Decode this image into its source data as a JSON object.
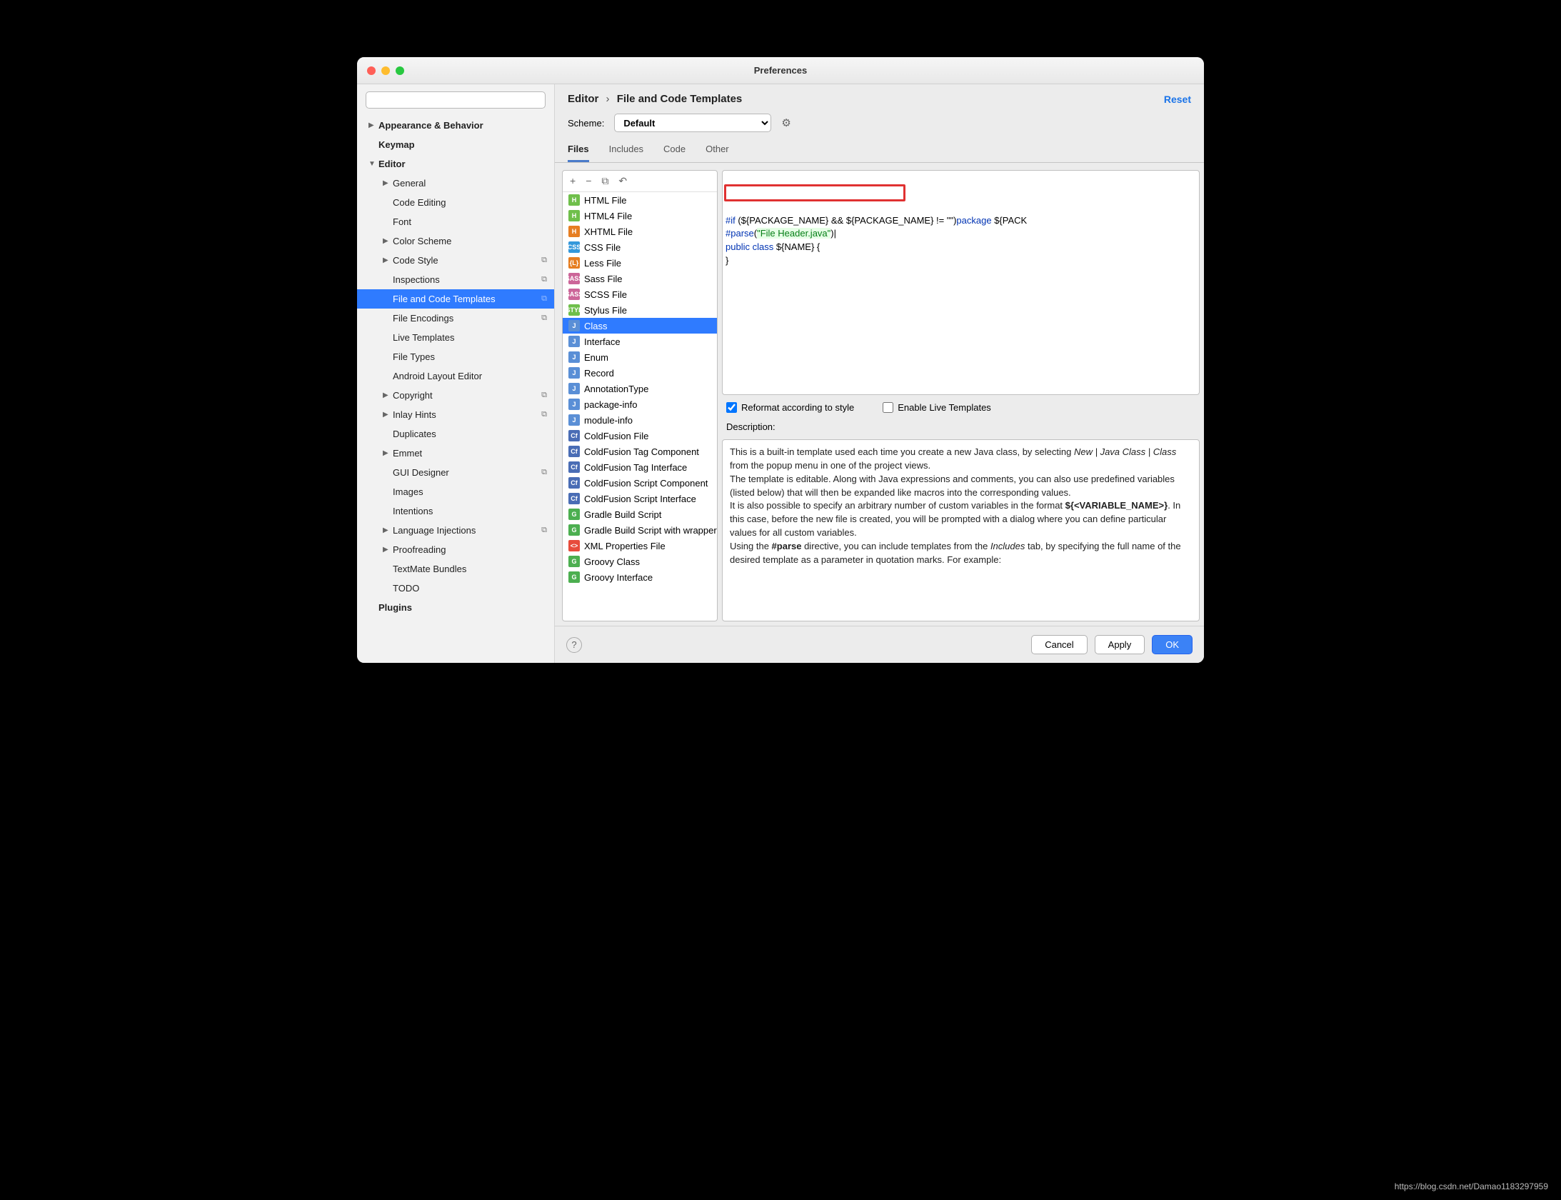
{
  "window_title": "Preferences",
  "search_placeholder": "",
  "sidebar": {
    "items": [
      {
        "label": "Appearance & Behavior",
        "level": 1,
        "arrow": "▶",
        "bold": true
      },
      {
        "label": "Keymap",
        "level": 1,
        "arrow": "",
        "bold": true
      },
      {
        "label": "Editor",
        "level": 1,
        "arrow": "▼",
        "bold": true
      },
      {
        "label": "General",
        "level": 2,
        "arrow": "▶"
      },
      {
        "label": "Code Editing",
        "level": 2,
        "arrow": ""
      },
      {
        "label": "Font",
        "level": 2,
        "arrow": ""
      },
      {
        "label": "Color Scheme",
        "level": 2,
        "arrow": "▶"
      },
      {
        "label": "Code Style",
        "level": 2,
        "arrow": "▶",
        "badge": "⧉"
      },
      {
        "label": "Inspections",
        "level": 2,
        "arrow": "",
        "badge": "⧉"
      },
      {
        "label": "File and Code Templates",
        "level": 2,
        "arrow": "",
        "badge": "⧉",
        "selected": true
      },
      {
        "label": "File Encodings",
        "level": 2,
        "arrow": "",
        "badge": "⧉"
      },
      {
        "label": "Live Templates",
        "level": 2,
        "arrow": ""
      },
      {
        "label": "File Types",
        "level": 2,
        "arrow": ""
      },
      {
        "label": "Android Layout Editor",
        "level": 2,
        "arrow": ""
      },
      {
        "label": "Copyright",
        "level": 2,
        "arrow": "▶",
        "badge": "⧉"
      },
      {
        "label": "Inlay Hints",
        "level": 2,
        "arrow": "▶",
        "badge": "⧉"
      },
      {
        "label": "Duplicates",
        "level": 2,
        "arrow": ""
      },
      {
        "label": "Emmet",
        "level": 2,
        "arrow": "▶"
      },
      {
        "label": "GUI Designer",
        "level": 2,
        "arrow": "",
        "badge": "⧉"
      },
      {
        "label": "Images",
        "level": 2,
        "arrow": ""
      },
      {
        "label": "Intentions",
        "level": 2,
        "arrow": ""
      },
      {
        "label": "Language Injections",
        "level": 2,
        "arrow": "▶",
        "badge": "⧉"
      },
      {
        "label": "Proofreading",
        "level": 2,
        "arrow": "▶"
      },
      {
        "label": "TextMate Bundles",
        "level": 2,
        "arrow": ""
      },
      {
        "label": "TODO",
        "level": 2,
        "arrow": ""
      },
      {
        "label": "Plugins",
        "level": 1,
        "arrow": "",
        "bold": true
      }
    ]
  },
  "breadcrumb": {
    "parent": "Editor",
    "sep": "›",
    "current": "File and Code Templates"
  },
  "reset_label": "Reset",
  "scheme": {
    "label": "Scheme:",
    "value": "Default"
  },
  "tabs": [
    "Files",
    "Includes",
    "Code",
    "Other"
  ],
  "active_tab": 0,
  "toolbar_icons": [
    "+",
    "−",
    "⧉",
    "↶"
  ],
  "file_templates": [
    {
      "name": "HTML File",
      "color": "#6fbf4b",
      "tag": "H"
    },
    {
      "name": "HTML4 File",
      "color": "#6fbf4b",
      "tag": "H"
    },
    {
      "name": "XHTML File",
      "color": "#e67e22",
      "tag": "H"
    },
    {
      "name": "CSS File",
      "color": "#3498db",
      "tag": "CSS"
    },
    {
      "name": "Less File",
      "color": "#e67e22",
      "tag": "{L}"
    },
    {
      "name": "Sass File",
      "color": "#cc6699",
      "tag": "SASS"
    },
    {
      "name": "SCSS File",
      "color": "#cc6699",
      "tag": "SASS"
    },
    {
      "name": "Stylus File",
      "color": "#6fbf4b",
      "tag": "STYL"
    },
    {
      "name": "Class",
      "color": "#5a8fd6",
      "tag": "J",
      "selected": true
    },
    {
      "name": "Interface",
      "color": "#5a8fd6",
      "tag": "J"
    },
    {
      "name": "Enum",
      "color": "#5a8fd6",
      "tag": "J"
    },
    {
      "name": "Record",
      "color": "#5a8fd6",
      "tag": "J"
    },
    {
      "name": "AnnotationType",
      "color": "#5a8fd6",
      "tag": "J"
    },
    {
      "name": "package-info",
      "color": "#5a8fd6",
      "tag": "J"
    },
    {
      "name": "module-info",
      "color": "#5a8fd6",
      "tag": "J"
    },
    {
      "name": "ColdFusion File",
      "color": "#4a6db5",
      "tag": "Cf"
    },
    {
      "name": "ColdFusion Tag Component",
      "color": "#4a6db5",
      "tag": "Cf"
    },
    {
      "name": "ColdFusion Tag Interface",
      "color": "#4a6db5",
      "tag": "Cf"
    },
    {
      "name": "ColdFusion Script Component",
      "color": "#4a6db5",
      "tag": "Cf"
    },
    {
      "name": "ColdFusion Script Interface",
      "color": "#4a6db5",
      "tag": "Cf"
    },
    {
      "name": "Gradle Build Script",
      "color": "#4caf50",
      "tag": "G"
    },
    {
      "name": "Gradle Build Script with wrapper",
      "color": "#4caf50",
      "tag": "G"
    },
    {
      "name": "XML Properties File",
      "color": "#e74c3c",
      "tag": "<>"
    },
    {
      "name": "Groovy Class",
      "color": "#4caf50",
      "tag": "G"
    },
    {
      "name": "Groovy Interface",
      "color": "#4caf50",
      "tag": "G"
    }
  ],
  "code_lines": [
    {
      "html": "<span class='kw'>#if</span> (${PACKAGE_NAME} &amp;&amp; ${PACKAGE_NAME} != \"\")<span class='kw'>package</span> ${PACK"
    },
    {
      "html": "<span class='kw'>#parse</span>(<span class='str'>\"File Header.java\"</span>)|"
    },
    {
      "html": "<span class='kw'>public class</span> ${NAME} {"
    },
    {
      "html": "}"
    }
  ],
  "checkbox1": {
    "label": "Reformat according to style",
    "checked": true
  },
  "checkbox2": {
    "label": "Enable Live Templates",
    "checked": false
  },
  "description_label": "Description:",
  "buttons": {
    "cancel": "Cancel",
    "apply": "Apply",
    "ok": "OK"
  },
  "watermark": "https://blog.csdn.net/Damao1183297959"
}
